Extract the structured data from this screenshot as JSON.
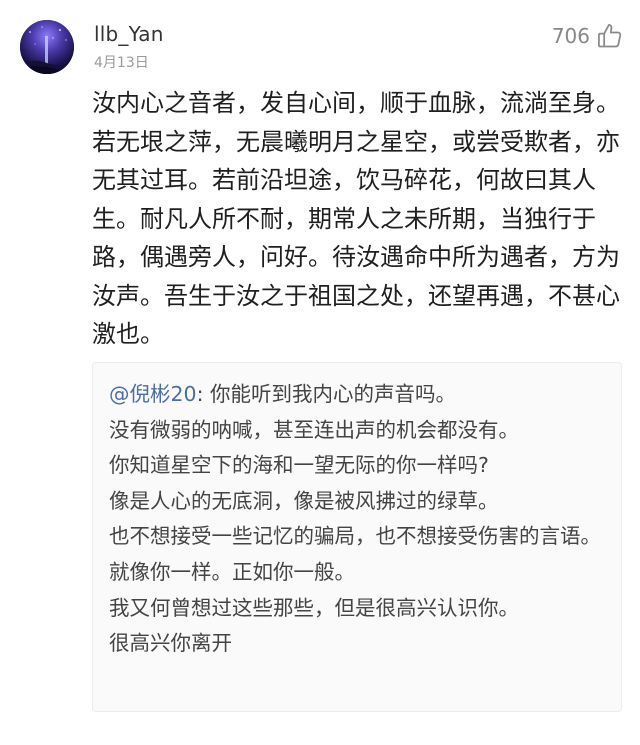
{
  "comment": {
    "username": "llb_Yan",
    "date": "4月13日",
    "like_count": "706",
    "icons": {
      "avatar": "avatar-starry-night",
      "like": "thumbs-up-icon"
    },
    "body": "汝内心之音者，发自心间，顺于血脉，流淌至身。若无垠之萍，无晨曦明月之星空，或尝受欺者，亦无其过耳。若前沿坦途，饮马碎花，何故曰其人生。耐凡人所不耐，期常人之未所期，当独行于路，偶遇旁人，问好。待汝遇命中所为遇者，方为汝声。吾生于汝之于祖国之处，还望再遇，不甚心激也。"
  },
  "quote": {
    "mention": "@倪彬20",
    "mention_suffix": ": 你能听到我内心的声音吗。",
    "lines": [
      "没有微弱的呐喊，甚至连出声的机会都没有。",
      "你知道星空下的海和一望无际的你一样吗?",
      "像是人心的无底洞，像是被风拂过的绿草。",
      "也不想接受一些记忆的骗局，也不想接受伤害的言语。",
      "就像你一样。正如你一般。",
      "我又何曾想过这些那些，但是很高兴认识你。",
      "很高兴你离开"
    ]
  },
  "colors": {
    "mention": "#4a6fa5",
    "quote_bg": "#fafafa",
    "text": "#1f1f1f",
    "muted": "#9a9a9a"
  }
}
